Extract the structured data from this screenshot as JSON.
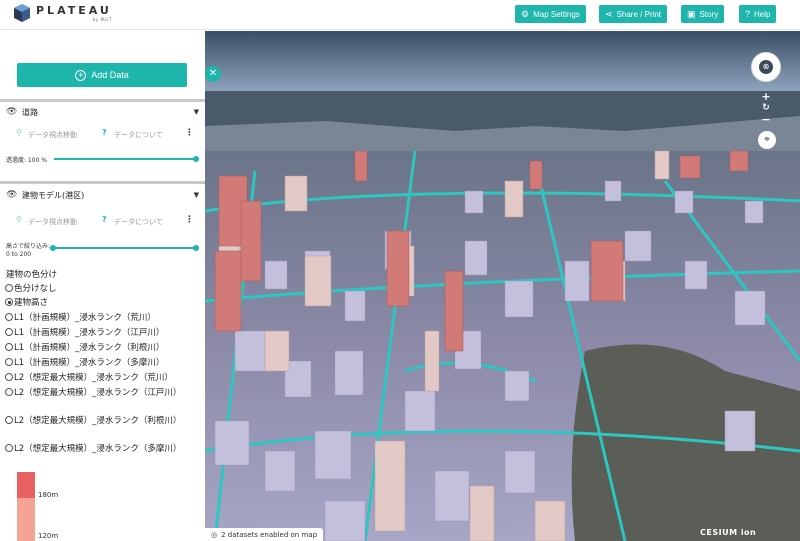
{
  "header": {
    "logo_text": "PLATEAU",
    "logo_sub": "by MLIT",
    "buttons": [
      {
        "label": "Map Settings",
        "icon": "sliders-icon"
      },
      {
        "label": "Share / Print",
        "icon": "share-icon"
      },
      {
        "label": "Story",
        "icon": "story-icon"
      },
      {
        "label": "Help",
        "icon": "help-icon"
      }
    ]
  },
  "sidebar": {
    "add_data_label": "Add Data",
    "layers": [
      {
        "name": "道路",
        "action_locate": "データ視点移動",
        "action_about": "データについて",
        "opacity_label": "透過度: 100 %"
      },
      {
        "name": "建物モデル(港区)",
        "action_locate": "データ視点移動",
        "action_about": "データについて",
        "height_filter_label": "高さで絞り込み:",
        "height_range": "0 to 200"
      }
    ],
    "color_legend": {
      "title": "建物の色分け",
      "options": [
        {
          "label": "色分けなし",
          "selected": false
        },
        {
          "label": "建物高さ",
          "selected": true
        },
        {
          "label": "L1（計画規模）_浸水ランク（荒川）",
          "selected": false
        },
        {
          "label": "L1（計画規模）_浸水ランク（江戸川）",
          "selected": false
        },
        {
          "label": "L1（計画規模）_浸水ランク（利根川）",
          "selected": false
        },
        {
          "label": "L1（計画規模）_浸水ランク（多摩川）",
          "selected": false
        },
        {
          "label": "L2（想定最大規模）_浸水ランク（荒川）",
          "selected": false
        },
        {
          "label": "L2（想定最大規模）_浸水ランク（江戸川）",
          "selected": false
        },
        {
          "label": "L2（想定最大規模）_浸水ランク（利根川）",
          "selected": false
        },
        {
          "label": "L2（想定最大規模）_浸水ランク（多摩川）",
          "selected": false
        }
      ],
      "scale": [
        {
          "label": "180m",
          "color": "#e8605f"
        },
        {
          "label": "120m",
          "color": "#f4a395"
        }
      ]
    }
  },
  "map": {
    "status_text": "2 datasets enabled on map",
    "attribution": "CESIUM ion",
    "accent_color": "#1eb5ad"
  }
}
